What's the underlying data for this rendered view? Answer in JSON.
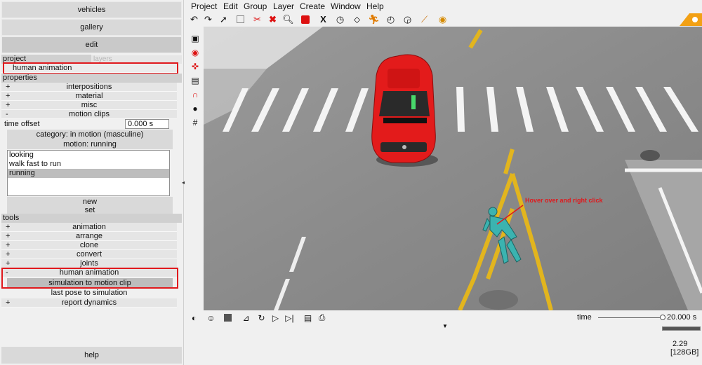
{
  "left_panel": {
    "buttons": {
      "vehicles": "vehicles",
      "gallery": "gallery",
      "edit": "edit",
      "help": "help"
    },
    "tabs": {
      "project": "project",
      "layers": "layers"
    },
    "project_item": "human animation",
    "properties": {
      "header": "properties",
      "rows": [
        {
          "sign": "+",
          "label": "interpositions"
        },
        {
          "sign": "+",
          "label": "material"
        },
        {
          "sign": "+",
          "label": "misc"
        },
        {
          "sign": "-",
          "label": "motion clips"
        }
      ],
      "time_offset_label": "time offset",
      "time_offset_value": "0.000 s",
      "category_button": "category: in motion (masculine)",
      "motion_button": "motion: running",
      "clips": [
        {
          "label": "looking",
          "selected": false
        },
        {
          "label": "walk fast to run",
          "selected": false
        },
        {
          "label": "running",
          "selected": true
        }
      ],
      "new_button": "new",
      "set_button": "set"
    },
    "tools": {
      "header": "tools",
      "rows": [
        {
          "sign": "+",
          "label": "animation"
        },
        {
          "sign": "+",
          "label": "arrange"
        },
        {
          "sign": "+",
          "label": "clone"
        },
        {
          "sign": "+",
          "label": "convert"
        },
        {
          "sign": "+",
          "label": "joints"
        },
        {
          "sign": "-",
          "label": "human animation"
        }
      ],
      "sim_to_clip_button": "simulation to motion clip",
      "last_pose_button": "last pose to simulation",
      "report_dynamics": {
        "sign": "+",
        "label": "report dynamics"
      }
    }
  },
  "menu": [
    "Project",
    "Edit",
    "Group",
    "Layer",
    "Create",
    "Window",
    "Help"
  ],
  "toolbar_icons": [
    "undo-icon",
    "redo-icon",
    "select-arrow-icon",
    "rectangle-select-icon",
    "delete-selection-icon",
    "delete-x-icon",
    "zoom-icon",
    "cube-icon",
    "axis-x-icon",
    "clock-icon",
    "road-icon",
    "run-icon",
    "speed-gauge-icon",
    "measure-icon",
    "settings-icon"
  ],
  "viewport": {
    "annotation": "Hover over and right click"
  },
  "status": {
    "time_label": "time",
    "time_value": "20.000 s",
    "progress": 1.0,
    "version": "2.29",
    "memory": "[128GB]"
  },
  "colors": {
    "highlight_box": "#e0191d",
    "car": "#e31b1b",
    "pedestrian": "#3bb3b0"
  }
}
